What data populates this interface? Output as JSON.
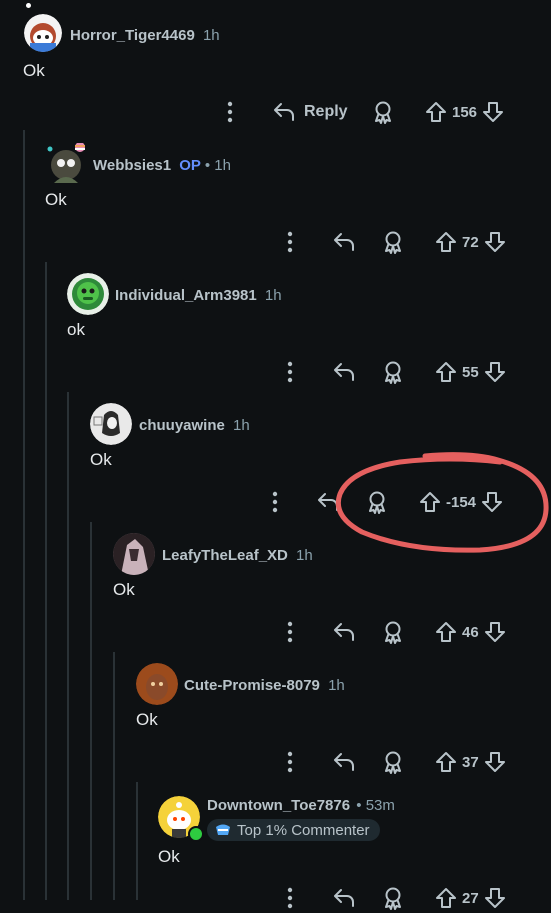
{
  "comments": [
    {
      "username": "Horror_Tiger4469",
      "time": "1h",
      "body": "Ok",
      "reply_label": "Reply",
      "score": "156"
    },
    {
      "username": "Webbsies1",
      "op": "OP",
      "sep": "•",
      "time": "1h",
      "body": "Ok",
      "score": "72"
    },
    {
      "username": "Individual_Arm3981",
      "time": "1h",
      "body": "ok",
      "score": "55"
    },
    {
      "username": "chuuyawine",
      "time": "1h",
      "body": "Ok",
      "score": "-154"
    },
    {
      "username": "LeafyTheLeaf_XD",
      "time": "1h",
      "body": "Ok",
      "score": "46"
    },
    {
      "username": "Cute-Promise-8079",
      "time": "1h",
      "body": "Ok",
      "score": "37"
    },
    {
      "username": "Downtown_Toe7876",
      "sep": "•",
      "time": "53m",
      "flair": "Top 1% Commenter",
      "body": "Ok",
      "score": "27"
    }
  ],
  "icons": {
    "more": "vertical-ellipsis-icon",
    "reply": "reply-arrow-icon",
    "award": "award-icon",
    "upvote": "upvote-arrow-icon",
    "downvote": "downvote-arrow-icon"
  },
  "colors": {
    "background": "#0e1113",
    "op_tag": "#648efc",
    "annotation_circle": "#e5605f",
    "online_dot": "#2ecc40"
  }
}
